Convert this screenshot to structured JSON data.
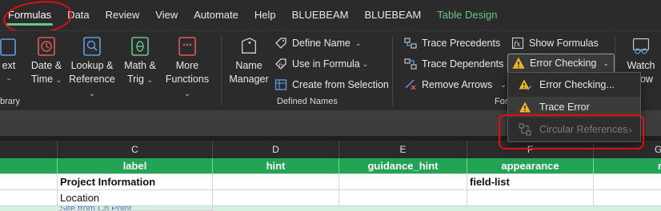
{
  "tabs": [
    "Formulas",
    "Data",
    "Review",
    "View",
    "Automate",
    "Help",
    "BLUEBEAM",
    "BLUEBEAM",
    "Table Design"
  ],
  "ribbon": {
    "function_library": {
      "text_btn": {
        "line1": "ext",
        "line2": "~"
      },
      "date_btn": {
        "line1": "Date &",
        "line2": "Time"
      },
      "lookup_btn": {
        "line1": "Lookup &",
        "line2": "Reference"
      },
      "math_btn": {
        "line1": "Math &",
        "line2": "Trig"
      },
      "more_btn": {
        "line1": "More",
        "line2": "Functions"
      },
      "group_label": "brary"
    },
    "defined_names": {
      "name_manager": {
        "line1": "Name",
        "line2": "Manager"
      },
      "define_name": "Define Name",
      "use_in_formula": "Use in Formula",
      "create_from_selection": "Create from Selection",
      "group_label": "Defined Names"
    },
    "formula_auditing": {
      "trace_precedents": "Trace Precedents",
      "trace_dependents": "Trace Dependents",
      "remove_arrows": "Remove Arrows",
      "show_formulas": "Show Formulas",
      "error_checking": "Error Checking",
      "group_label": "For"
    },
    "watch": {
      "line1": "Watch",
      "line2": "ndow"
    }
  },
  "dropdown": {
    "items": [
      "Error Checking...",
      "Trace Error",
      "Circular References"
    ]
  },
  "columns": [
    "C",
    "D",
    "E",
    "F",
    "G"
  ],
  "table": {
    "headers": [
      "label",
      "hint",
      "guidance_hint",
      "appearance",
      "requ"
    ],
    "rows": [
      [
        "Project Information",
        "",
        "",
        "field-list",
        ""
      ],
      [
        "Location",
        "",
        "",
        "",
        ""
      ]
    ],
    "partial_row": "Site from Cp Point"
  },
  "colors": {
    "accent_green": "#6bc58a",
    "table_header": "#21a454",
    "annotation_red": "#e01010"
  }
}
